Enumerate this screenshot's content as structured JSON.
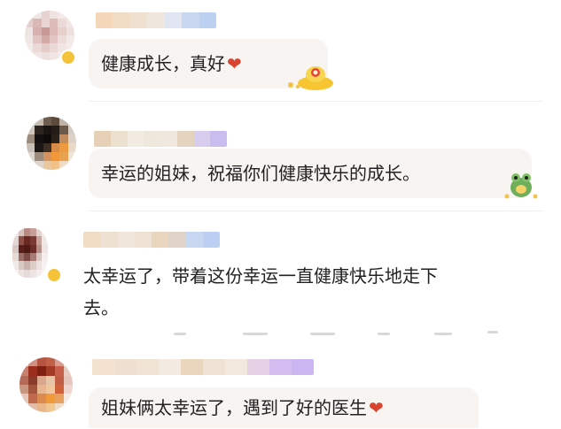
{
  "comments": [
    {
      "text": "健康成长，真好",
      "emoji": "❤"
    },
    {
      "text": "幸运的姐妹，祝福你们健康快乐的成长。"
    },
    {
      "text_line1": "太幸运了，带着这份幸运一直健康快乐地走下",
      "text_line2": "去。"
    },
    {
      "text": "姐妹俩太幸运了，遇到了好的医生",
      "emoji": "❤"
    }
  ],
  "colors": {
    "bubble": "#f8f4f2",
    "text": "#222222",
    "heart": "#d9432f",
    "badge": "#f5c33a"
  }
}
